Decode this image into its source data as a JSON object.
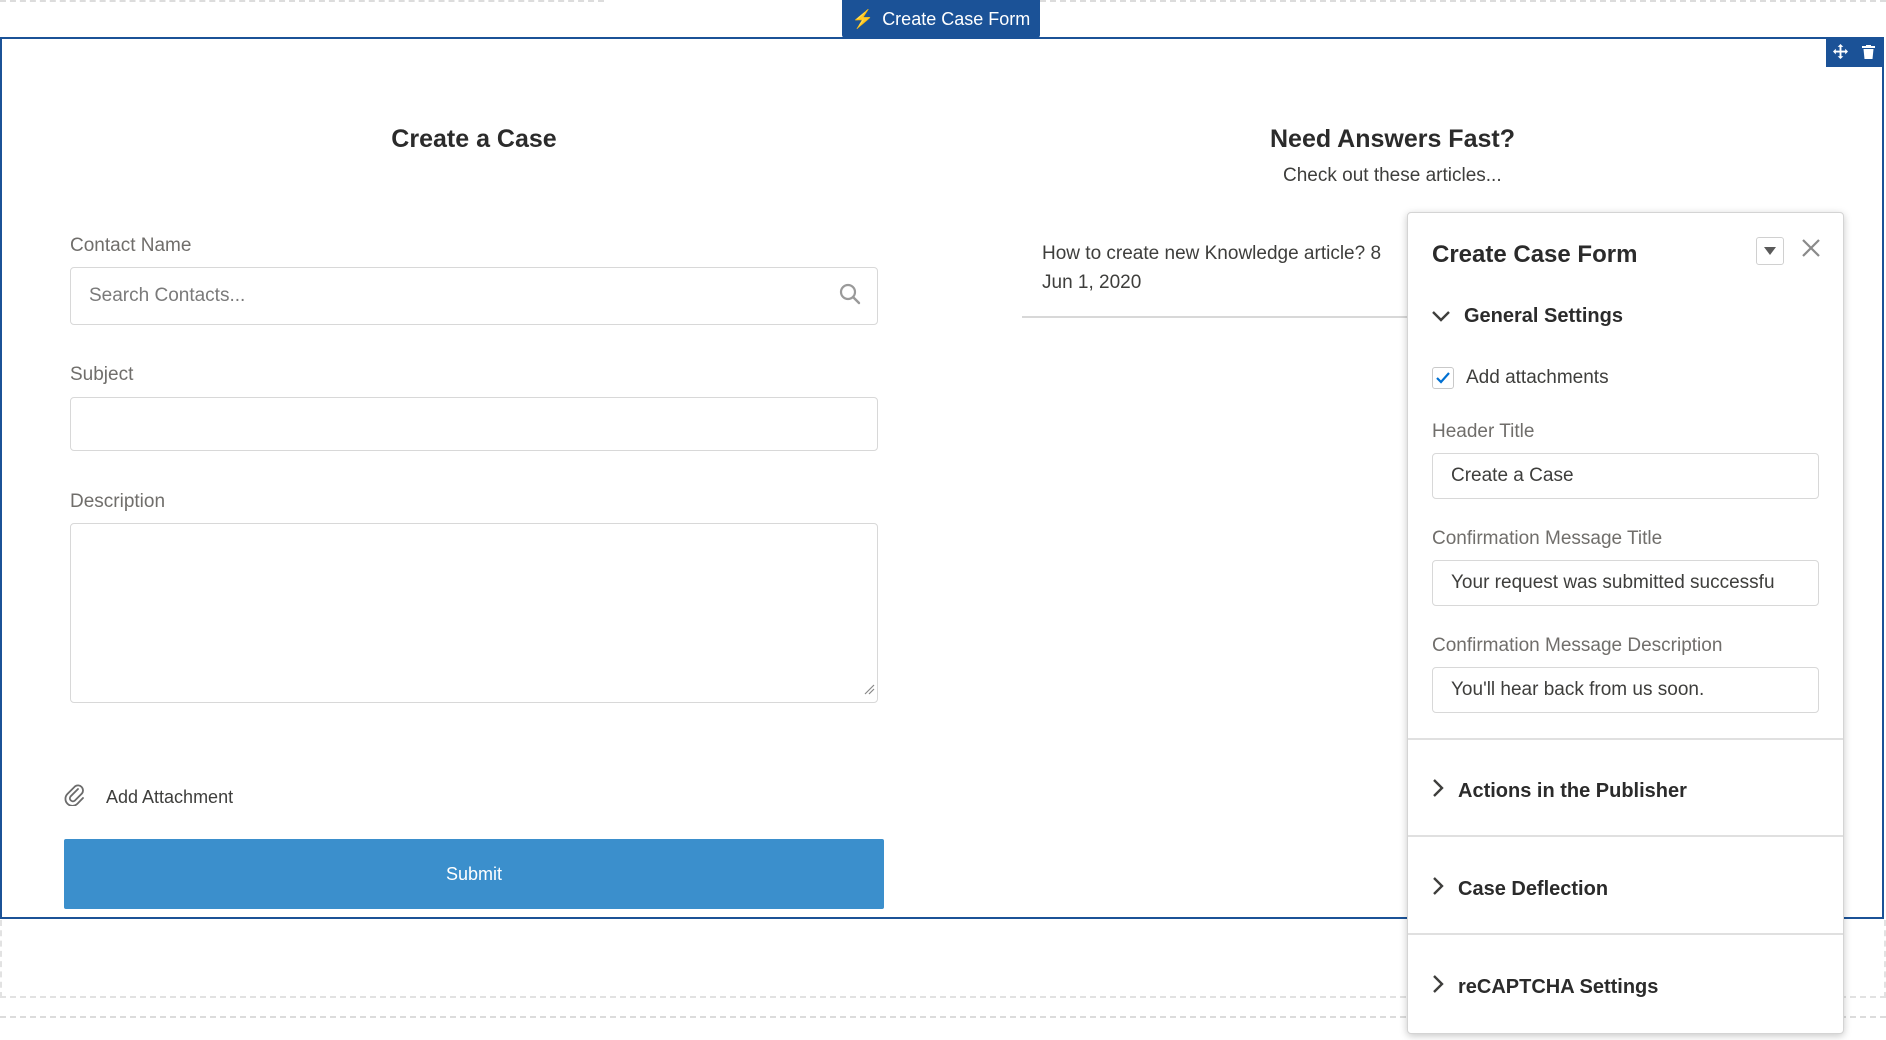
{
  "component_tab": {
    "label": "Create Case Form",
    "icon": "lightning-bolt-icon"
  },
  "frame_controls": {
    "move_icon": "move-icon",
    "delete_icon": "trash-icon"
  },
  "form": {
    "title": "Create a Case",
    "contact_label": "Contact Name",
    "contact_placeholder": "Search Contacts...",
    "subject_label": "Subject",
    "subject_value": "",
    "description_label": "Description",
    "description_value": "",
    "attachment_label": "Add Attachment",
    "submit_label": "Submit"
  },
  "answers": {
    "title": "Need Answers Fast?",
    "subtitle": "Check out these articles...",
    "articles": [
      {
        "title": "How to create new Knowledge article? 8",
        "date": "Jun 1, 2020"
      }
    ]
  },
  "panel": {
    "title": "Create Case Form",
    "general_settings": {
      "heading": "General Settings",
      "add_attachments_label": "Add attachments",
      "add_attachments_checked": true,
      "header_title_label": "Header Title",
      "header_title_value": "Create a Case",
      "confirm_title_label": "Confirmation Message Title",
      "confirm_title_value": "Your request was submitted successfu",
      "confirm_desc_label": "Confirmation Message Description",
      "confirm_desc_value": "You'll hear back from us soon."
    },
    "sections": [
      {
        "label": "Actions in the Publisher"
      },
      {
        "label": "Case Deflection"
      },
      {
        "label": "reCAPTCHA Settings"
      }
    ]
  },
  "colors": {
    "accent": "#1b5297",
    "submit": "#3b8fcc",
    "check": "#0070d2"
  }
}
